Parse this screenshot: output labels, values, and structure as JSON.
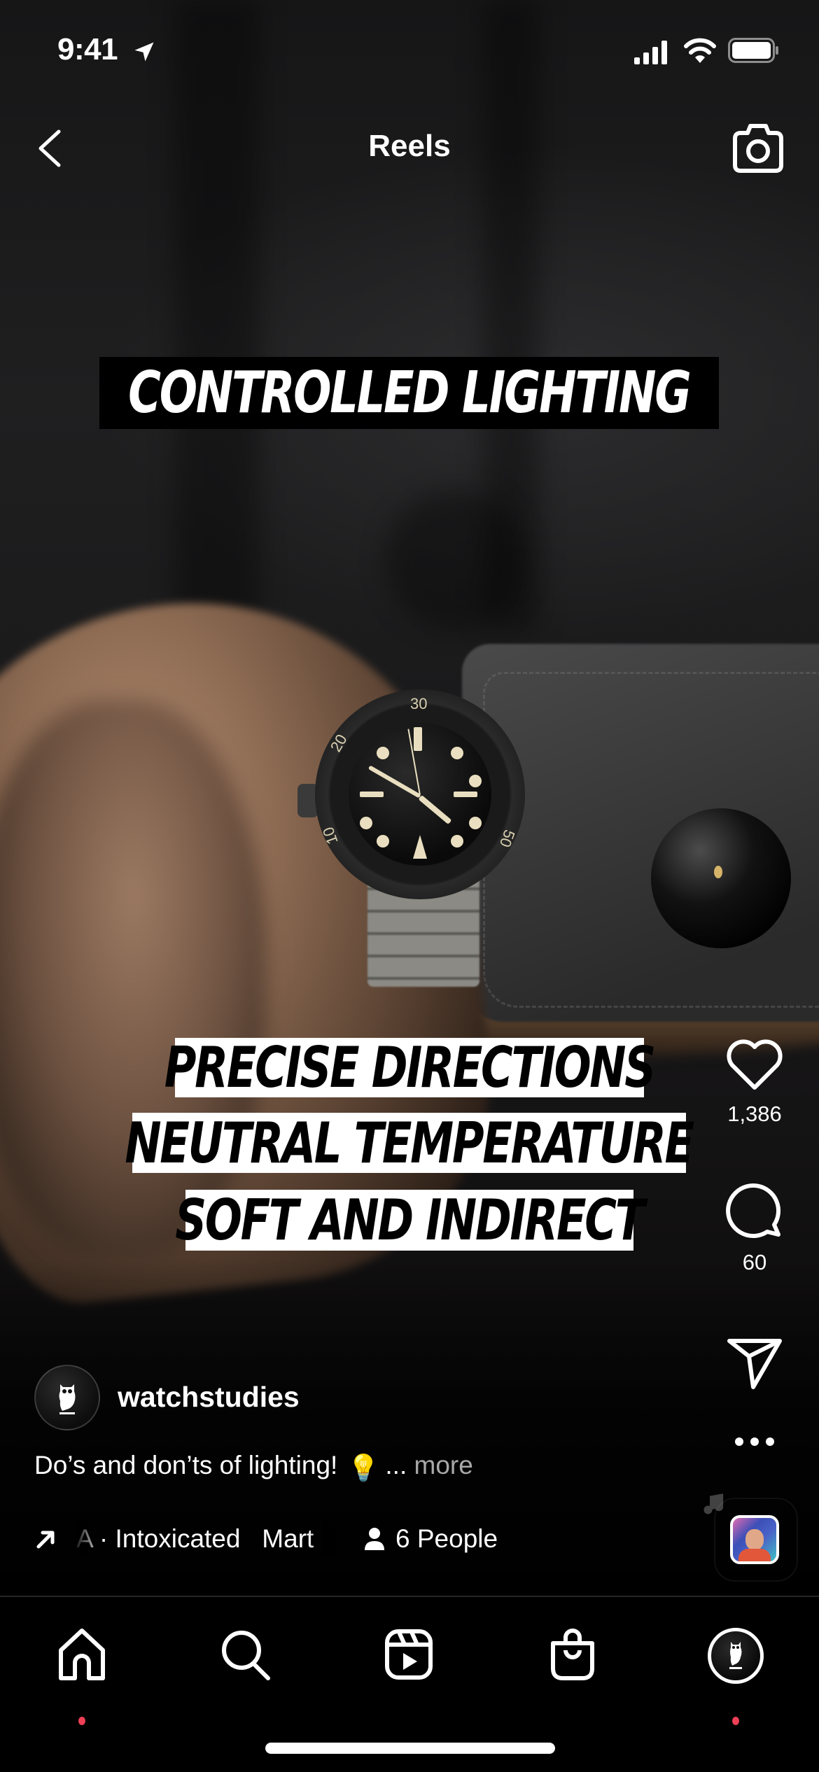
{
  "status_bar": {
    "time": "9:41",
    "icons": [
      "location-arrow-icon",
      "cellular-signal-icon",
      "wifi-icon",
      "battery-icon"
    ]
  },
  "header": {
    "title": "Reels",
    "back_icon": "chevron-left-icon",
    "camera_icon": "camera-icon"
  },
  "video": {
    "overlay_title": "CONTROLLED LIGHTING",
    "overlay_lines": [
      "PRECISE DIRECTIONS",
      "NEUTRAL TEMPERATURE",
      "SOFT AND INDIRECT"
    ],
    "watch_bezel_numbers": [
      "30",
      "20",
      "10",
      "50"
    ]
  },
  "actions": {
    "like": {
      "icon": "heart-icon",
      "count": "1,386"
    },
    "comment": {
      "icon": "comment-bubble-icon",
      "count": "60"
    },
    "share": {
      "icon": "paper-plane-icon"
    },
    "more": {
      "icon": "more-dots-icon"
    },
    "audio": {
      "icon": "music-note-icon"
    }
  },
  "post": {
    "author": "watchstudies",
    "caption": "Do’s and don’ts of lighting!",
    "caption_emoji": "💡",
    "ellipsis": "...",
    "more_label": "more",
    "audio_text": "A · Intoxicated   Mart",
    "people_label": "6 People"
  },
  "tab_bar": {
    "tabs": [
      {
        "name": "home",
        "icon": "home-icon",
        "has_badge": true
      },
      {
        "name": "search",
        "icon": "search-icon",
        "has_badge": false
      },
      {
        "name": "reels",
        "icon": "reels-icon",
        "has_badge": false
      },
      {
        "name": "shop",
        "icon": "shopping-bag-icon",
        "has_badge": false
      },
      {
        "name": "profile",
        "icon": "profile-avatar",
        "has_badge": true
      }
    ]
  },
  "colors": {
    "badge": "#ef4056",
    "more_text": "#a8a8a8",
    "tab_bar_bg": "#000000"
  }
}
